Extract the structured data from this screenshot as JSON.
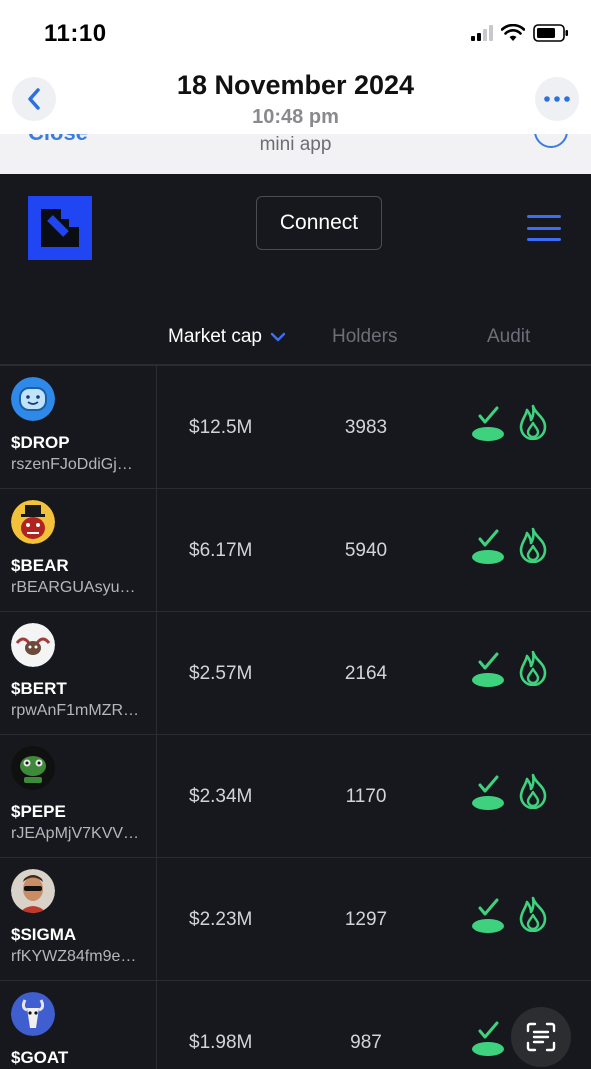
{
  "status_bar": {
    "time": "11:10",
    "icons": [
      "cellular-signal-icon",
      "wifi-icon",
      "battery-icon"
    ]
  },
  "viewer": {
    "date": "18 November 2024",
    "time": "10:48 pm",
    "icons": [
      "chevron-left-icon",
      "more-dots-icon"
    ]
  },
  "mini_app": {
    "close_label": "Close",
    "title": "mini app"
  },
  "app": {
    "connect_label": "Connect",
    "accent_color": "#1f46f2",
    "positive_color": "#3fd27e"
  },
  "table": {
    "columns": [
      "Market cap",
      "Holders",
      "Audit"
    ],
    "sort_column": "Market cap",
    "sort_direction": "descending",
    "rows": [
      {
        "ticker": "$DROP",
        "address": "rszenFJoDdiGj…",
        "market_cap": "$12.5M",
        "holders": "3983"
      },
      {
        "ticker": "$BEAR",
        "address": "rBEARGUAsyu…",
        "market_cap": "$6.17M",
        "holders": "5940"
      },
      {
        "ticker": "$BERT",
        "address": "rpwAnF1mMZR…",
        "market_cap": "$2.57M",
        "holders": "2164"
      },
      {
        "ticker": "$PEPE",
        "address": "rJEApMjV7KVV…",
        "market_cap": "$2.34M",
        "holders": "1170"
      },
      {
        "ticker": "$SIGMA",
        "address": "rfKYWZ84fm9e…",
        "market_cap": "$2.23M",
        "holders": "1297"
      },
      {
        "ticker": "$GOAT",
        "address": "",
        "market_cap": "$1.98M",
        "holders": "987"
      }
    ]
  }
}
